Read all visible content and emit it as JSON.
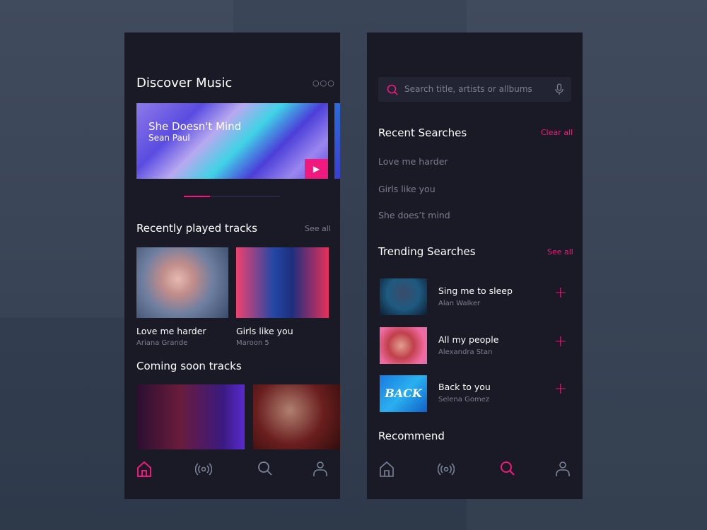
{
  "colors": {
    "accent": "#f0197d",
    "panel": "#1a1a27",
    "background": "#364356"
  },
  "discover": {
    "title": "Discover Music",
    "more_icon": "more-dots-icon",
    "carousel": {
      "title": "She Doesn't Mind",
      "artist": "Sean Paul",
      "play_icon": "play-icon",
      "page": 1,
      "pages": 4
    },
    "recent": {
      "title": "Recently played tracks",
      "see_all": "See all",
      "items": [
        {
          "title": "Love me harder",
          "artist": "Ariana Grande"
        },
        {
          "title": "Girls like you",
          "artist": "Maroon 5"
        }
      ]
    },
    "coming": {
      "title": "Coming soon tracks"
    },
    "nav": {
      "active": "home",
      "items": [
        "home-icon",
        "radio-icon",
        "search-icon",
        "profile-icon"
      ]
    }
  },
  "search": {
    "placeholder": "Search title, artists or allbums",
    "recent": {
      "title": "Recent Searches",
      "clear": "Clear all",
      "items": [
        "Love me harder",
        "Girls like you",
        "She does’t mind"
      ]
    },
    "trending": {
      "title": "Trending Searches",
      "see_all": "See all",
      "items": [
        {
          "title": "Sing me to sleep",
          "artist": "Alan Walker",
          "thumb_text": ""
        },
        {
          "title": "All my people",
          "artist": "Alexandra Stan",
          "thumb_text": ""
        },
        {
          "title": "Back to you",
          "artist": "Selena Gomez",
          "thumb_text": "BACK"
        }
      ]
    },
    "recommend": {
      "title": "Recommend"
    },
    "nav": {
      "active": "search",
      "items": [
        "home-icon",
        "radio-icon",
        "search-icon",
        "profile-icon"
      ]
    }
  }
}
